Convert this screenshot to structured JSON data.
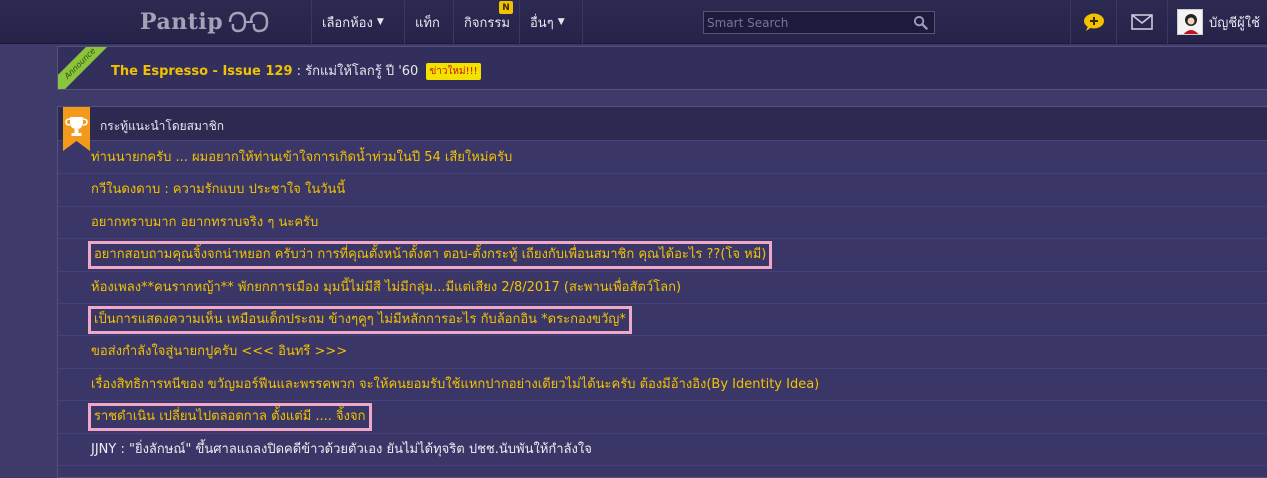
{
  "brand": {
    "name": "Pantip"
  },
  "nav": {
    "rooms": "เลือกห้อง",
    "tags": "แท็ก",
    "activities": "กิจกรรม",
    "activities_badge": "N",
    "more": "อื่นๆ"
  },
  "search": {
    "placeholder": "Smart Search"
  },
  "user": {
    "account_label": "บัญชีผู้ใช้"
  },
  "announce": {
    "ribbon": "Announce",
    "link": "The Espresso - Issue 129",
    "text": " : รักแม่ให้โลกรู้ ปี '60",
    "badge": "ข่าวใหม่!!!"
  },
  "recommended": {
    "title": "กระทู้แนะนำโดยสมาชิก",
    "topics": [
      "ท่านนายกครับ ... ผมอยากให้ท่านเข้าใจการเกิดน้ำท่วมในปี 54 เสียใหม่ครับ",
      "กวีในดงดาบ : ความรักแบบ ประชาใจ ในวันนี้",
      "อยากทราบมาก อยากทราบจริง ๆ นะครับ",
      "อยากสอบถามคุณจิ้งจกน่าหยอก ครับว่า การที่คุณตั้งหน้าตั้งตา ตอบ-ตั้งกระทู้ เถียงกับเพื่อนสมาชิก คุณได้อะไร ??(โจ หมี)",
      "ห้องเพลง**คนรากหญ้า** พักยกการเมือง มุมนี้ไม่มีสี ไม่มีกลุ่ม...มีแต่เสียง 2/8/2017 (สะพานเพื่อสัตว์โลก)",
      "เป็นการแสดงความเห็น เหมือนเด็กประถม ข้างๆคูๆ ไม่มีหลักการอะไร กับล้อกอิน *ดระกองขวัญ*",
      "ขอส่งกำลังใจสู่นายกปูครับ <<< อินทรี >>>",
      "เรื่องสิทธิการหนีของ ขวัญมอร์ฟีนและพรรคพวก จะให้คนยอมรับใช้แหกปากอย่างเดียวไม่ได้นะครับ ต้องมีอ้างอิง(By Identity Idea)",
      "ราชดำเนิน เปลี่ยนไปตลอดกาล ตั้งแต่มี .... จิ้งจก",
      "JJNY : \"ยิ่งลักษณ์\" ขึ้นศาลแถลงปิดคดีข้าวด้วยตัวเอง ยันไม่ได้ทุจริต ปชช.นับพันให้กำลังใจ"
    ]
  },
  "colors": {
    "background": "#3e3b6b",
    "topic_link": "#f2c200",
    "highlight_border": "#f0a8c8"
  }
}
